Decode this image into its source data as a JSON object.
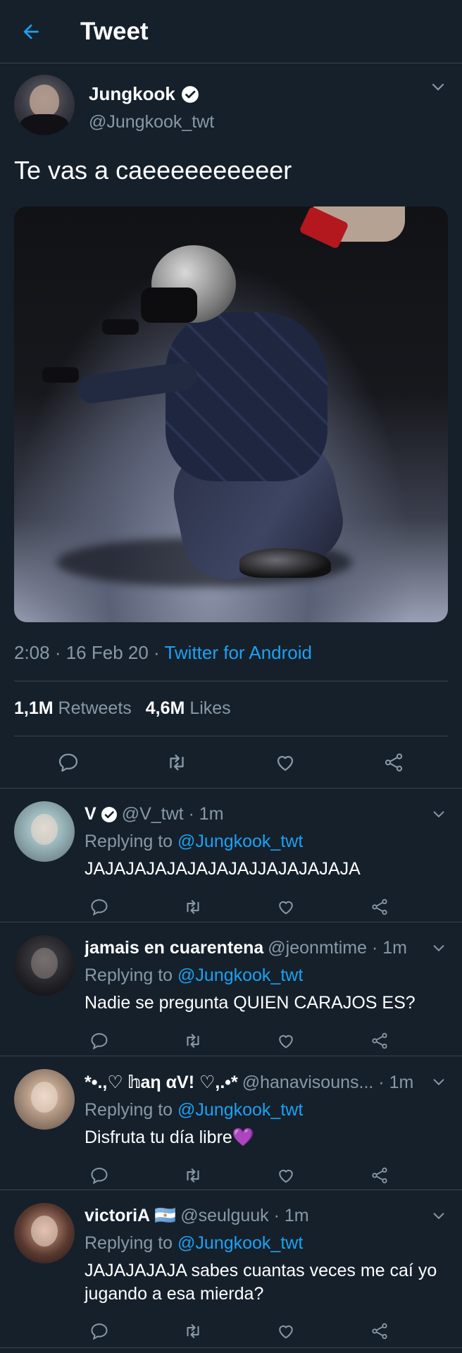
{
  "header": {
    "title": "Tweet"
  },
  "tweet": {
    "author_name": "Jungkook",
    "author_handle": "@Jungkook_twt",
    "text": "Te vas a caeeeeeeeeeer",
    "time": "2:08",
    "date": "16 Feb 20",
    "separator": " · ",
    "source": "Twitter for Android",
    "retweets_count": "1,1M",
    "retweets_label": "Retweets",
    "likes_count": "4,6M",
    "likes_label": "Likes"
  },
  "replies": [
    {
      "name": "V",
      "handle": "@V_twt · 1m",
      "verified": true,
      "replying_label": "Replying to",
      "replying_to": "@Jungkook_twt",
      "text": "JAJAJAJAJAJAJAJAJJAJAJAJAJA"
    },
    {
      "name": "jamais en cuarentena",
      "handle": "@jeonmtime · 1m",
      "verified": false,
      "replying_label": "Replying to",
      "replying_to": "@Jungkook_twt",
      "text": "Nadie se pregunta QUIEN CARAJOS ES?"
    },
    {
      "name": "*•.,♡ 𝕙aη αV! ♡,.•*",
      "handle": "@hanavisouns... · 1m",
      "verified": false,
      "replying_label": "Replying to",
      "replying_to": "@Jungkook_twt",
      "text": "Disfruta tu día libre",
      "emoji": "💜"
    },
    {
      "name": "victoriA 🇦🇷",
      "handle": "@seulguuk · 1m",
      "verified": false,
      "replying_label": "Replying to",
      "replying_to": "@Jungkook_twt",
      "text": "JAJAJAJAJA sabes cuantas veces me caí yo jugando a esa mierda?"
    }
  ],
  "colors": {
    "background": "#15202b",
    "accent": "#1da1f2",
    "muted": "#8899a6",
    "divider": "#38444d"
  }
}
